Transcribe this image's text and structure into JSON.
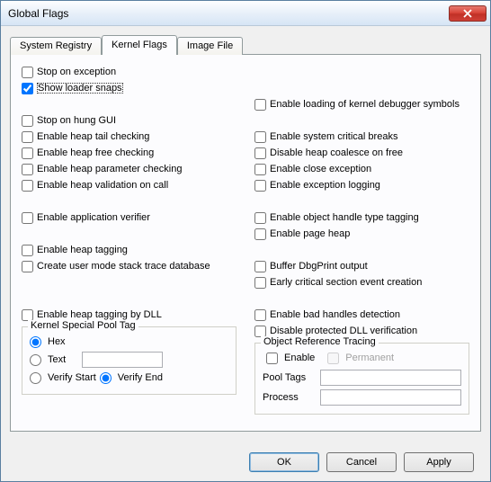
{
  "window": {
    "title": "Global Flags"
  },
  "tabs": {
    "registry": "System Registry",
    "kernel": "Kernel Flags",
    "image": "Image File"
  },
  "left": {
    "stop_exception": "Stop on exception",
    "show_loader": "Show loader snaps",
    "stop_hung": "Stop on hung GUI",
    "heap_tail": "Enable heap tail checking",
    "heap_free": "Enable heap free checking",
    "heap_param": "Enable heap parameter checking",
    "heap_valid": "Enable heap validation on call",
    "app_verifier": "Enable application verifier",
    "heap_tagging": "Enable heap tagging",
    "stack_trace": "Create user mode stack trace database",
    "heap_tag_dll": "Enable heap tagging by DLL"
  },
  "right": {
    "load_kdbg": "Enable loading of kernel debugger symbols",
    "sys_crit": "Enable system critical breaks",
    "disable_coalesce": "Disable heap coalesce on free",
    "close_exc": "Enable close exception",
    "exc_log": "Enable exception logging",
    "obj_tag": "Enable object handle type tagging",
    "page_heap": "Enable page heap",
    "dbg_print": "Buffer DbgPrint output",
    "early_cs": "Early critical section event creation",
    "bad_handles": "Enable bad handles detection",
    "disable_dll_verif": "Disable protected DLL verification"
  },
  "kernel_pool": {
    "legend": "Kernel Special Pool Tag",
    "hex": "Hex",
    "text": "Text",
    "verify_start": "Verify Start",
    "verify_end": "Verify End",
    "value": ""
  },
  "obj_ref": {
    "legend": "Object Reference Tracing",
    "enable": "Enable",
    "permanent": "Permanent",
    "pool_tags_lbl": "Pool Tags",
    "process_lbl": "Process",
    "pool_tags": "",
    "process": ""
  },
  "buttons": {
    "ok": "OK",
    "cancel": "Cancel",
    "apply": "Apply"
  }
}
